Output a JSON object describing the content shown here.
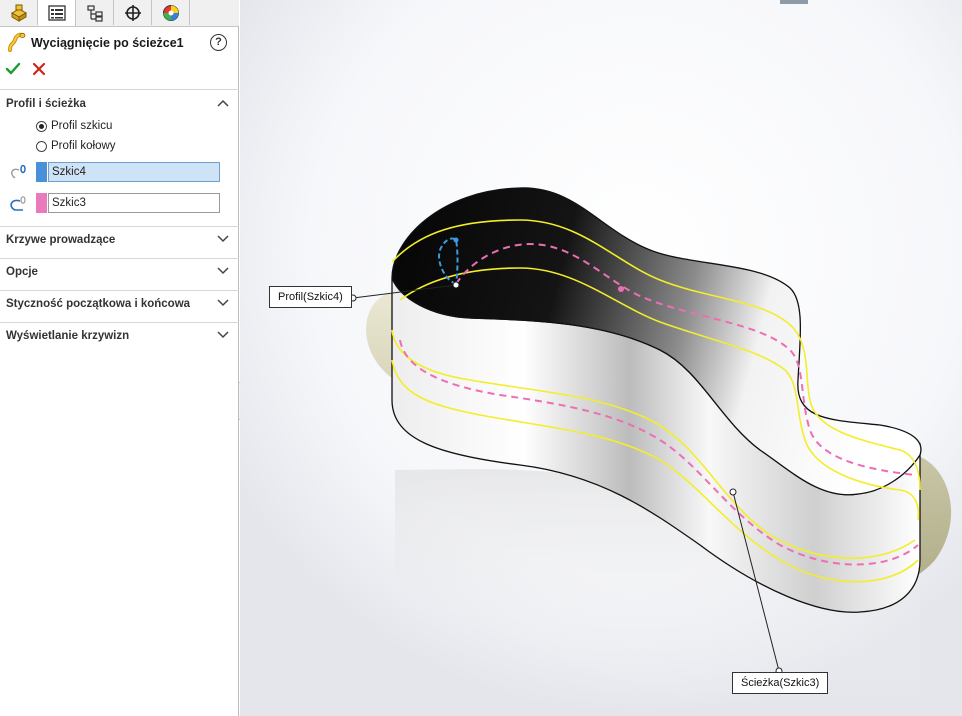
{
  "window": {
    "tabs": [
      {
        "name": "feature-manager-icon"
      },
      {
        "name": "property-manager-icon"
      },
      {
        "name": "configuration-manager-icon"
      },
      {
        "name": "dimxpert-manager-icon"
      },
      {
        "name": "display-manager-icon"
      }
    ],
    "active_tab": 1
  },
  "property_manager": {
    "title": "Wyciągnięcie po ścieżce1",
    "help_icon": "question-icon",
    "help_label": "?",
    "ok_icon": "checkmark-icon",
    "cancel_icon": "close-icon"
  },
  "sections": {
    "profile_path": {
      "label": "Profil i ścieżka",
      "expanded": true,
      "options": [
        {
          "label": "Profil szkicu",
          "checked": true
        },
        {
          "label": "Profil kołowy",
          "checked": false
        }
      ],
      "profile_field": {
        "value": "Szkic4",
        "color": "#4a90d9",
        "active": true
      },
      "path_field": {
        "value": "Szkic3",
        "color": "#e97bbd",
        "active": false
      }
    },
    "guide_curves": {
      "label": "Krzywe prowadzące",
      "expanded": false
    },
    "options": {
      "label": "Opcje",
      "expanded": false
    },
    "tangency": {
      "label": "Styczność początkowa i końcowa",
      "expanded": false
    },
    "curvature_display": {
      "label": "Wyświetlanie krzywizn",
      "expanded": false
    }
  },
  "viewport": {
    "callouts": {
      "profile": "Profil(Szkic4)",
      "path": "Ścieżka(Szkic3)"
    },
    "colors": {
      "profile_sketch": "#3b9be0",
      "path_sketch": "#ec6fb5",
      "preview_edges": "#f2ee2a",
      "preview_tube": "#c9c6a2"
    }
  }
}
